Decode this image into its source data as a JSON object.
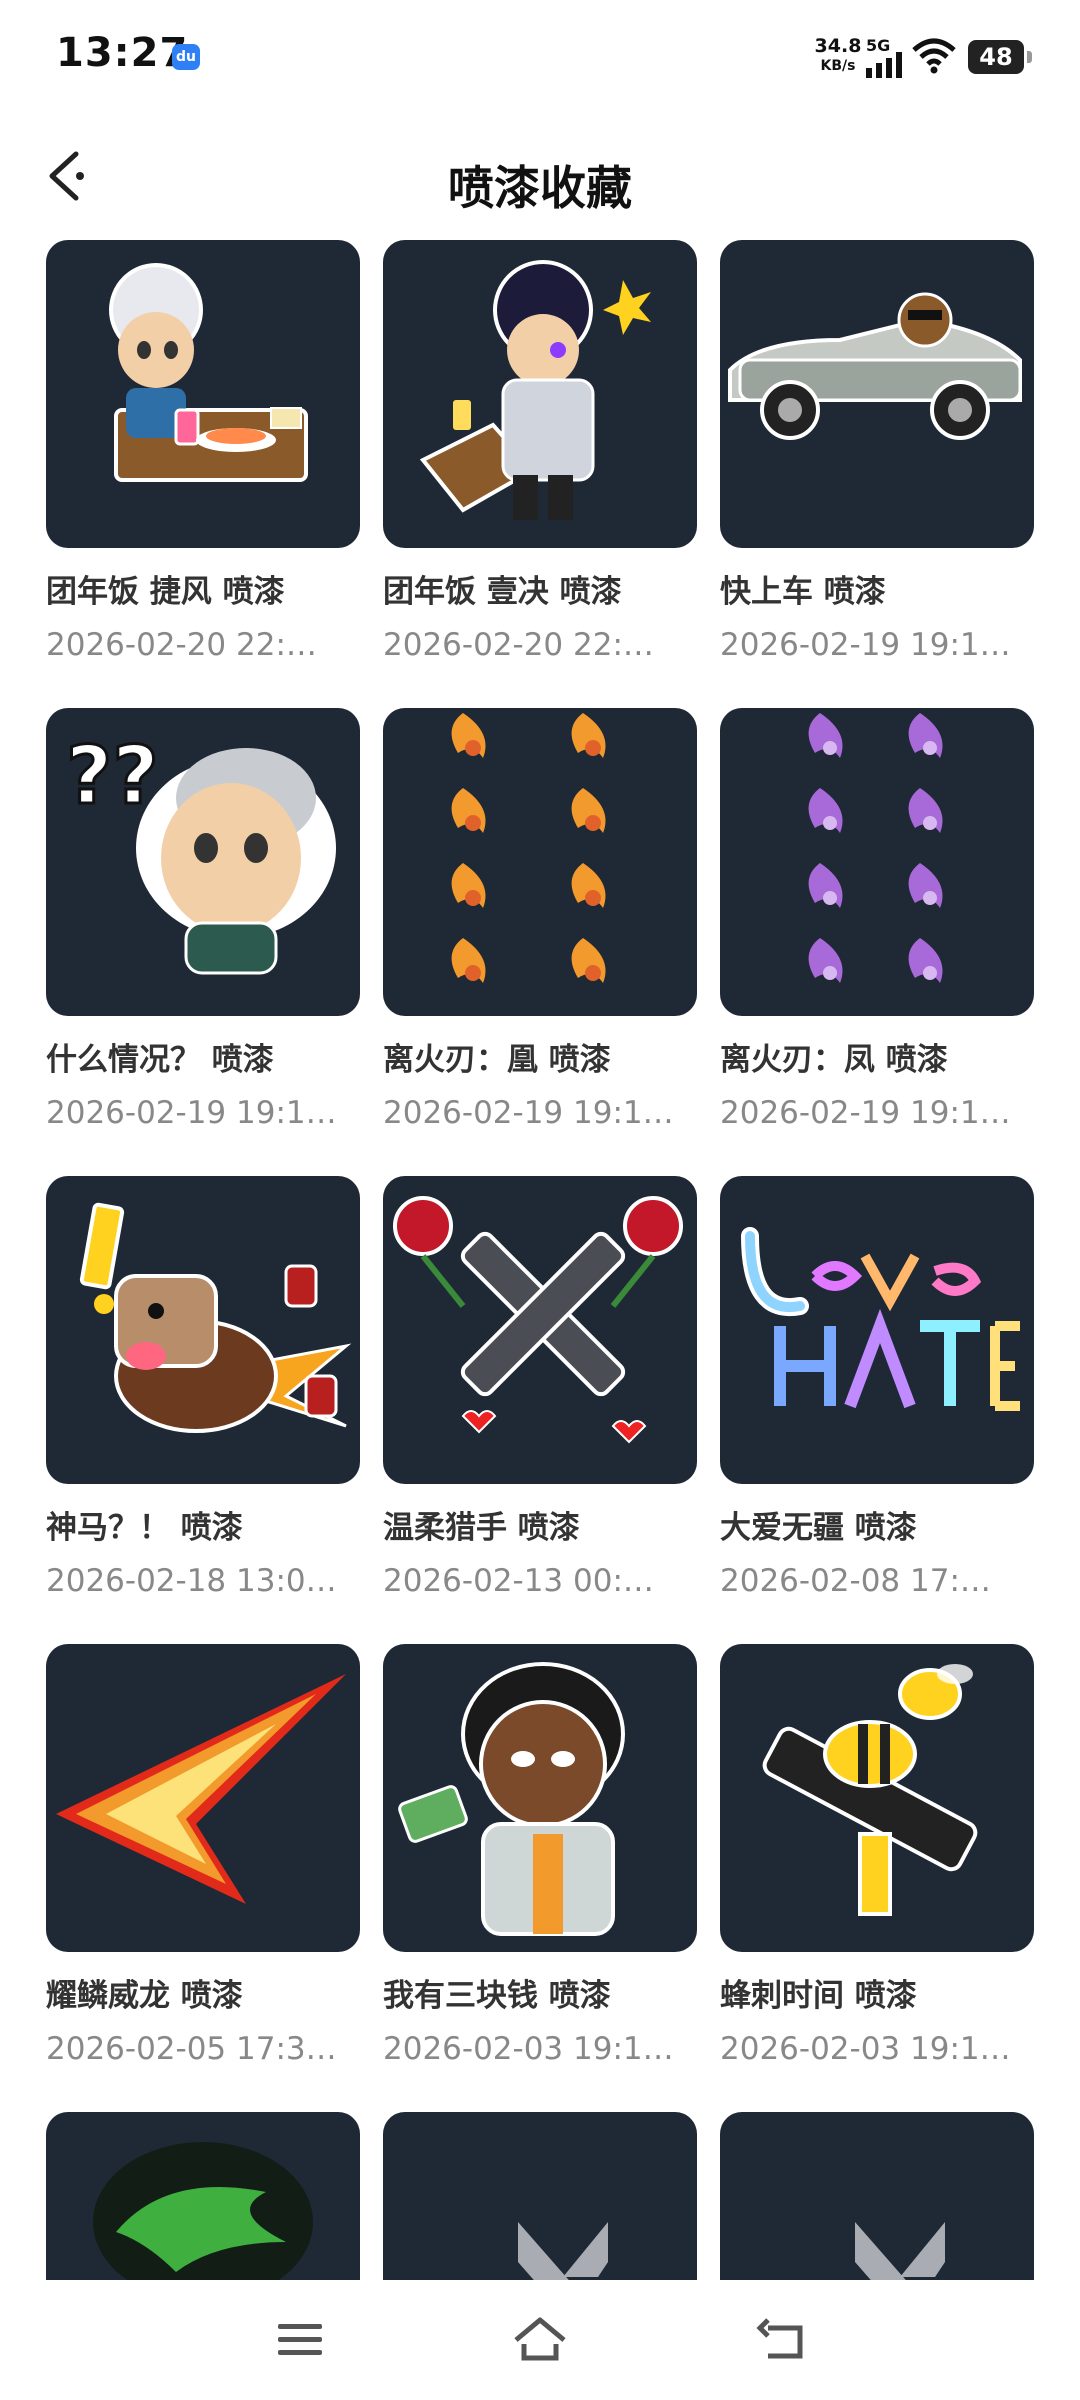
{
  "status_bar": {
    "time": "13:27",
    "du_badge": "du",
    "speed_value": "34.8",
    "speed_unit": "KB/s",
    "network": "5G",
    "battery": "48"
  },
  "header": {
    "title": "喷漆收藏",
    "back_icon": "chevron-left-icon"
  },
  "sprays": [
    {
      "name": "团年饭 捷风 喷漆",
      "date": "2026-02-20 22:…",
      "art": "chibi-jett-eating"
    },
    {
      "name": "团年饭 壹决 喷漆",
      "date": "2026-02-20 22:…",
      "art": "chibi-iso-eating"
    },
    {
      "name": "快上车 喷漆",
      "date": "2026-02-19 19:1…",
      "art": "bear-in-car"
    },
    {
      "name": "什么情况？ 喷漆",
      "date": "2026-02-19 19:1…",
      "art": "confused-agent"
    },
    {
      "name": "  离火刃：凰 喷漆",
      "date": "2026-02-19 19:1…",
      "art": "fire-phoenix-pattern"
    },
    {
      "name": "离火刃：凤 喷漆",
      "date": "2026-02-19 19:1…",
      "art": "purple-phoenix-pattern"
    },
    {
      "name": "神马？！ 喷漆",
      "date": "2026-02-18 13:0…",
      "art": "horse-explosion"
    },
    {
      "name": "温柔猎手 喷漆",
      "date": "2026-02-13 00:…",
      "art": "crossed-revolvers-roses"
    },
    {
      "name": "大爱无疆 喷漆",
      "date": "2026-02-08 17:…",
      "art": "love-over-hate"
    },
    {
      "name": "耀鳞威龙 喷漆",
      "date": "2026-02-05 17:3…",
      "art": "flame-arrow"
    },
    {
      "name": "我有三块钱 喷漆",
      "date": "2026-02-03 19:1…",
      "art": "agent-with-cash"
    },
    {
      "name": "蜂刺时间 喷漆",
      "date": "2026-02-03 19:1…",
      "art": "bee-gun"
    },
    {
      "name": "",
      "date": "",
      "art": "green-dragon"
    },
    {
      "name": "",
      "date": "",
      "art": "valorant-logo"
    },
    {
      "name": "",
      "date": "",
      "art": "valorant-logo"
    }
  ],
  "nav": {
    "menu_icon": "menu-icon",
    "home_icon": "home-icon",
    "back_icon": "back-icon"
  },
  "colors": {
    "thumb_bg": "#1f2935",
    "title_text": "#111111",
    "date_text": "#888888"
  }
}
